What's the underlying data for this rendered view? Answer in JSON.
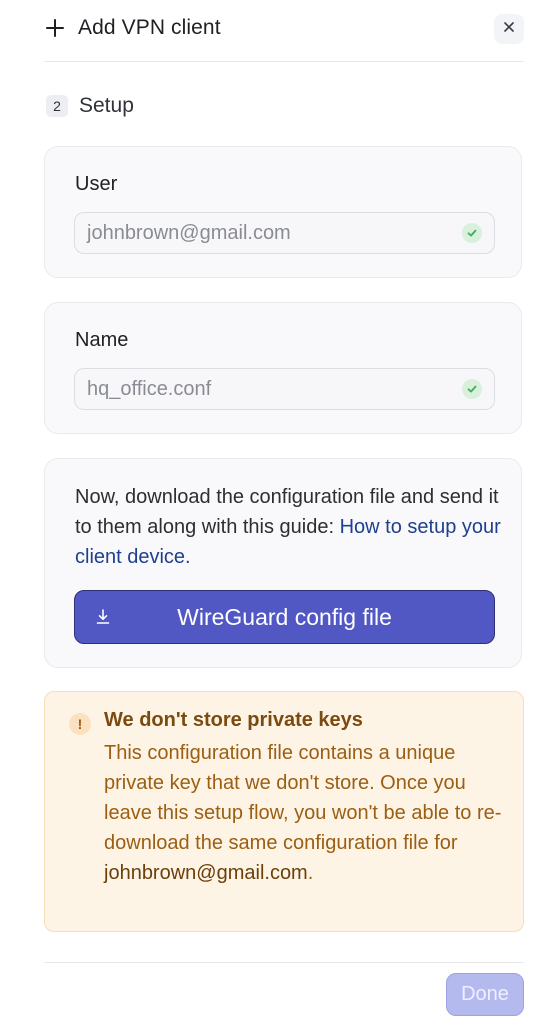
{
  "header": {
    "title": "Add VPN client",
    "add_icon": "plus-icon",
    "close_icon": "close-icon"
  },
  "step": {
    "number": "2",
    "label": "Setup"
  },
  "user_field": {
    "label": "User",
    "value": "johnbrown@gmail.com",
    "status_icon": "check-circle-icon"
  },
  "name_field": {
    "label": "Name",
    "value": "hq_office.conf",
    "status_icon": "check-circle-icon"
  },
  "download": {
    "text": "Now, download the configuration file and send it to them along with this guide: ",
    "link_text": "How to setup your client device.",
    "button_label": "WireGuard config file",
    "button_icon": "download-icon"
  },
  "warning": {
    "icon": "exclamation-icon",
    "icon_glyph": "!",
    "title": "We don't store private keys",
    "body": "This configuration file contains a unique private key that we don't store. Once you leave this setup flow, you won't be able to re-download the same configuration file for ",
    "email": "johnbrown@gmail.com",
    "suffix": "."
  },
  "footer": {
    "done_label": "Done"
  },
  "colors": {
    "accent": "#5158c4",
    "accent_disabled": "#b4b9ee",
    "success": "#3fae55",
    "warning_bg": "#fef4e6",
    "warning_text": "#9b5e12",
    "link": "#1f3f8f"
  }
}
